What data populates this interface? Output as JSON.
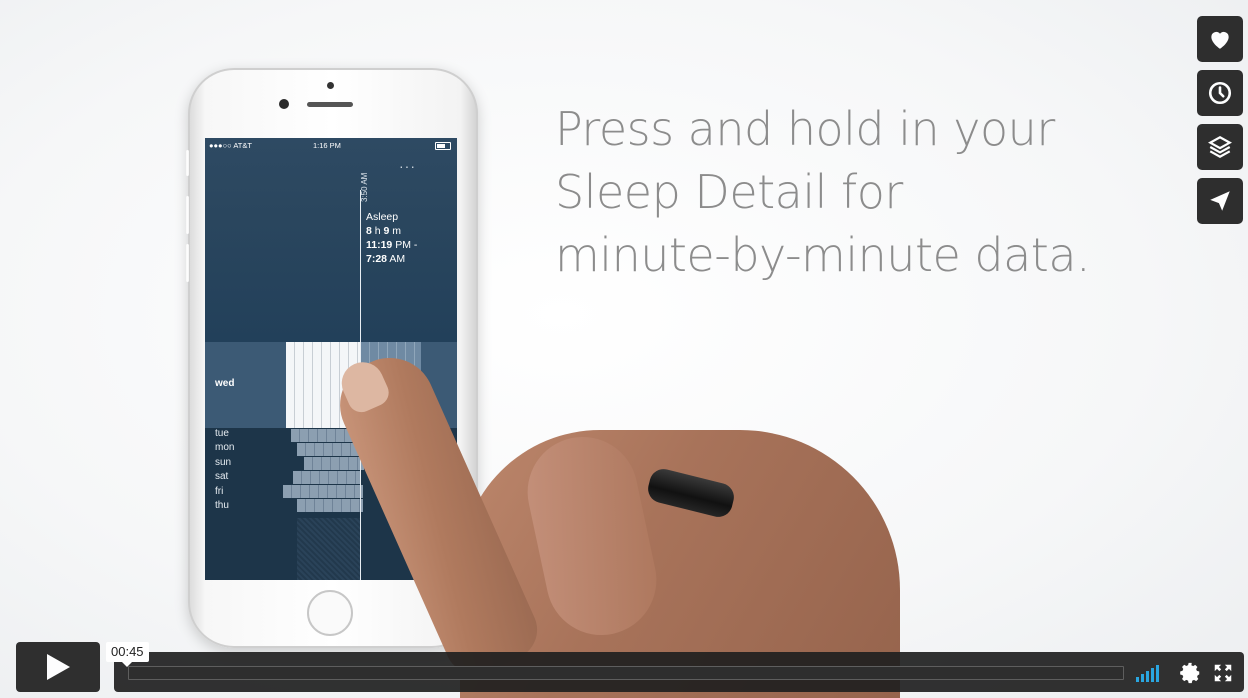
{
  "caption": {
    "line1": "Press and hold in your",
    "line2": "Sleep Detail for",
    "line3": "minute-by-minute data."
  },
  "phone_screen": {
    "status": {
      "carrier": "●●●○○ AT&T",
      "time": "1:16 PM"
    },
    "menu_dots": "···",
    "cursor_time": "3:50 AM",
    "asleep_label": "Asleep",
    "duration_h": "8",
    "duration_h_unit": " h ",
    "duration_m": "9",
    "duration_m_unit": " m",
    "start_time": "11:19",
    "start_suffix": " PM -",
    "end_time": "7:28",
    "end_suffix": " AM",
    "selected_day": "wed",
    "days": [
      "tue",
      "mon",
      "sun",
      "sat",
      "fri",
      "thu"
    ]
  },
  "player": {
    "timecode": "00:45",
    "colors": {
      "bar": "#1f1f1f",
      "volume": "#2aa6e0"
    }
  },
  "sidebar_icons": [
    "heart-icon",
    "clock-icon",
    "layers-icon",
    "send-icon"
  ]
}
